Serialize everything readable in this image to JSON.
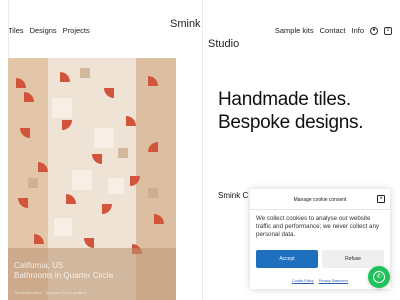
{
  "nav": {
    "left": [
      "Tiles",
      "Designs",
      "Projects"
    ],
    "right": [
      "Sample kits",
      "Contact",
      "Info"
    ],
    "account_icon": "user-icon",
    "cart_icon": "cart-icon"
  },
  "logo": {
    "line1": "Smink",
    "line2": "Studio"
  },
  "project": {
    "location": "California, US",
    "title": "Bathrooms in Quarter Circle",
    "credits": "Terracotta tiles · Quarter Circle pattern"
  },
  "hero": {
    "line1": "Handmade tiles.",
    "line2": "Bespoke designs.",
    "subline": "Smink C"
  },
  "cookie": {
    "title": "Manage cookie consent",
    "close_icon": "close-icon",
    "text": "We collect cookies to analyse our website traffic and performance; we never collect any personal data.",
    "accept": "Accept",
    "refuse": "Refuse",
    "links": [
      "Cookie Policy",
      "Privacy Statement"
    ]
  },
  "whatsapp": {
    "icon": "whatsapp-icon",
    "color": "#1fc15a"
  },
  "colors": {
    "accent": "#1f6fbf",
    "tile_orange": "#d2543a",
    "tile_sand": "#e8c8a6"
  }
}
